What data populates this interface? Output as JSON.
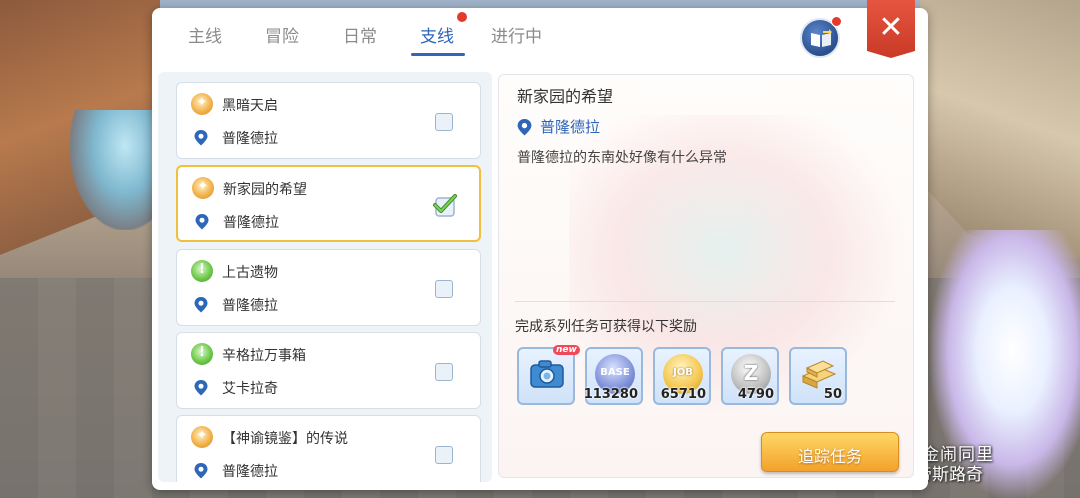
{
  "tabs": [
    {
      "label": "主线"
    },
    {
      "label": "冒险"
    },
    {
      "label": "日常"
    },
    {
      "label": "支线",
      "active": true,
      "has_notification": true
    },
    {
      "label": "进行中"
    }
  ],
  "icons": {
    "guide_book": "book-arrow-icon",
    "close": "close-x-icon",
    "location": "map-pin-icon",
    "quest_orange": "quest-orange-icon",
    "quest_green": "quest-green-icon",
    "checkbox": "checkbox-icon",
    "checkmark": "green-checkmark-icon"
  },
  "close_label": "✕",
  "quests": [
    {
      "title": "黑暗天启",
      "location": "普隆德拉",
      "icon": "orange",
      "checked": false,
      "selected": false
    },
    {
      "title": "新家园的希望",
      "location": "普隆德拉",
      "icon": "orange",
      "checked": true,
      "selected": true
    },
    {
      "title": "上古遗物",
      "location": "普隆德拉",
      "icon": "green",
      "checked": false,
      "selected": false
    },
    {
      "title": "辛格拉万事箱",
      "location": "艾卡拉奇",
      "icon": "green",
      "checked": false,
      "selected": false
    },
    {
      "title": "【神谕镜鉴】的传说",
      "location": "普隆德拉",
      "icon": "orange",
      "checked": false,
      "selected": false
    }
  ],
  "detail": {
    "title": "新家园的希望",
    "location": "普隆德拉",
    "description": "普隆德拉的东南处好像有什么异常",
    "reward_header": "完成系列任务可获得以下奖励",
    "rewards": [
      {
        "icon": "camera-icon",
        "label": "",
        "new_tag": "new"
      },
      {
        "icon": "base-exp-icon",
        "label": "BASE",
        "quantity": "113280"
      },
      {
        "icon": "job-exp-icon",
        "label": "JOB",
        "quantity": "65710"
      },
      {
        "icon": "zeny-coin-icon",
        "label": "Z",
        "quantity": "4790"
      },
      {
        "icon": "gold-bars-icon",
        "label": "",
        "quantity": "50"
      }
    ],
    "track_button": "追踪任务"
  },
  "world": {
    "map_label_1": "金闹同里",
    "map_label_2": "尔帝斯路奇"
  },
  "colors": {
    "accent": "#2e66b8",
    "notification": "#e43a2d",
    "close": "#d5432f",
    "selected_border": "#f0bf3e",
    "track_button": "#f2a22a"
  }
}
